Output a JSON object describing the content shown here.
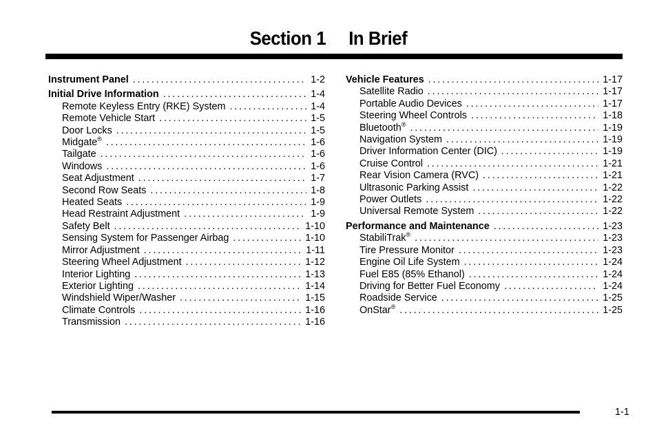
{
  "header": {
    "section": "Section 1",
    "title": "In Brief"
  },
  "columns": {
    "left": [
      {
        "label": "Instrument Panel",
        "page": "1-2",
        "level": "heading"
      },
      {
        "label": "Initial Drive Information",
        "page": "1-4",
        "level": "heading"
      },
      {
        "label": "Remote Keyless Entry (RKE) System",
        "page": "1-4",
        "level": "sub"
      },
      {
        "label": "Remote Vehicle Start",
        "page": "1-5",
        "level": "sub"
      },
      {
        "label": "Door Locks",
        "page": "1-5",
        "level": "sub"
      },
      {
        "label": "Midgate",
        "sup": "®",
        "page": "1-6",
        "level": "sub"
      },
      {
        "label": "Tailgate",
        "page": "1-6",
        "level": "sub"
      },
      {
        "label": "Windows",
        "page": "1-6",
        "level": "sub"
      },
      {
        "label": "Seat Adjustment",
        "page": "1-7",
        "level": "sub"
      },
      {
        "label": "Second Row Seats",
        "page": "1-8",
        "level": "sub"
      },
      {
        "label": "Heated Seats",
        "page": "1-9",
        "level": "sub"
      },
      {
        "label": "Head Restraint Adjustment",
        "page": "1-9",
        "level": "sub"
      },
      {
        "label": "Safety Belt",
        "page": "1-10",
        "level": "sub"
      },
      {
        "label": "Sensing System for Passenger Airbag",
        "page": "1-10",
        "level": "sub"
      },
      {
        "label": "Mirror Adjustment",
        "page": "1-11",
        "level": "sub"
      },
      {
        "label": "Steering Wheel Adjustment",
        "page": "1-12",
        "level": "sub"
      },
      {
        "label": "Interior Lighting",
        "page": "1-13",
        "level": "sub"
      },
      {
        "label": "Exterior Lighting",
        "page": "1-14",
        "level": "sub"
      },
      {
        "label": "Windshield Wiper/Washer",
        "page": "1-15",
        "level": "sub"
      },
      {
        "label": "Climate Controls",
        "page": "1-16",
        "level": "sub"
      },
      {
        "label": "Transmission",
        "page": "1-16",
        "level": "sub"
      }
    ],
    "right": [
      {
        "label": "Vehicle Features",
        "page": "1-17",
        "level": "heading"
      },
      {
        "label": "Satellite Radio",
        "page": "1-17",
        "level": "sub"
      },
      {
        "label": "Portable Audio Devices",
        "page": "1-17",
        "level": "sub"
      },
      {
        "label": "Steering Wheel Controls",
        "page": "1-18",
        "level": "sub"
      },
      {
        "label": "Bluetooth",
        "sup": "®",
        "page": "1-19",
        "level": "sub"
      },
      {
        "label": "Navigation System",
        "page": "1-19",
        "level": "sub"
      },
      {
        "label": "Driver Information Center (DIC)",
        "page": "1-19",
        "level": "sub"
      },
      {
        "label": "Cruise Control",
        "page": "1-21",
        "level": "sub"
      },
      {
        "label": "Rear Vision Camera (RVC)",
        "page": "1-21",
        "level": "sub"
      },
      {
        "label": "Ultrasonic Parking Assist",
        "page": "1-22",
        "level": "sub"
      },
      {
        "label": "Power Outlets",
        "page": "1-22",
        "level": "sub"
      },
      {
        "label": "Universal Remote System",
        "page": "1-22",
        "level": "sub"
      },
      {
        "label": "Performance and Maintenance",
        "page": "1-23",
        "level": "heading"
      },
      {
        "label": "StabiliTrak",
        "sup": "®",
        "page": "1-23",
        "level": "sub"
      },
      {
        "label": "Tire Pressure Monitor",
        "page": "1-23",
        "level": "sub"
      },
      {
        "label": "Engine Oil Life System",
        "page": "1-24",
        "level": "sub"
      },
      {
        "label": "Fuel E85 (85% Ethanol)",
        "page": "1-24",
        "level": "sub"
      },
      {
        "label": "Driving for Better Fuel Economy",
        "page": "1-24",
        "level": "sub"
      },
      {
        "label": "Roadside Service",
        "page": "1-25",
        "level": "sub"
      },
      {
        "label": "OnStar",
        "sup": "®",
        "page": "1-25",
        "level": "sub"
      }
    ]
  },
  "footer": {
    "page_number": "1-1"
  }
}
